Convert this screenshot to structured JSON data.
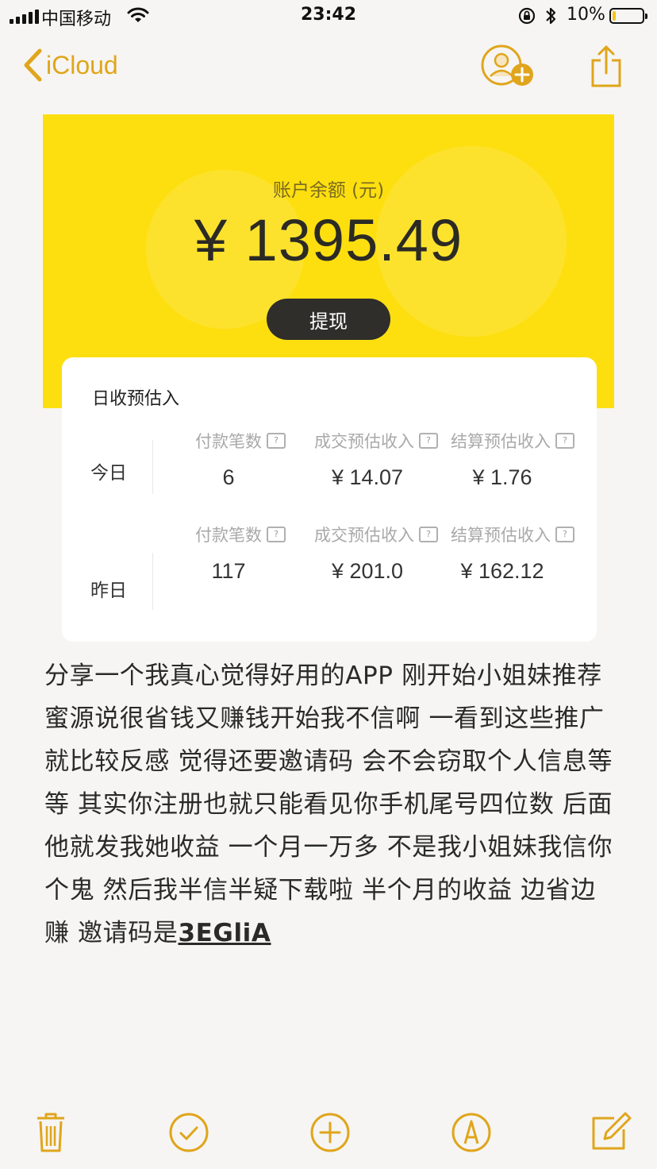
{
  "status_bar": {
    "carrier": "中国移动",
    "time": "23:42",
    "battery_percent": "10%",
    "battery_level": 0.1
  },
  "nav": {
    "back_label": "iCloud",
    "accent_color": "#e0a51c"
  },
  "screenshot": {
    "balance_label": "账户余额 (元)",
    "balance_value": "¥ 1395.49",
    "withdraw_label": "提现",
    "card_title": "日收预估入",
    "rows": [
      {
        "label": "今日",
        "headers": [
          "付款笔数",
          "成交预估收入",
          "结算预估收入"
        ],
        "values": [
          "6",
          "¥ 14.07",
          "¥ 1.76"
        ]
      },
      {
        "label": "昨日",
        "headers": [
          "付款笔数",
          "成交预估收入",
          "结算预估收入"
        ],
        "values": [
          "117",
          "¥ 201.0",
          "¥ 162.12"
        ]
      }
    ],
    "help_glyph": "?"
  },
  "note": {
    "body": "分享一个我真心觉得好用的APP 刚开始小姐妹推荐蜜源说很省钱又赚钱开始我不信啊 一看到这些推广就比较反感 觉得还要邀请码 会不会窃取个人信息等等 其实你注册也就只能看见你手机尾号四位数 后面他就发我她收益 一个月一万多 不是我小姐妹我信你个鬼 然后我半信半疑下载啦 半个月的收益 边省边赚 邀请码是",
    "invite_code": "3EGliA"
  },
  "toolbar": {
    "icons": [
      "trash-icon",
      "checklist-icon",
      "add-icon",
      "markup-icon",
      "compose-icon"
    ]
  }
}
